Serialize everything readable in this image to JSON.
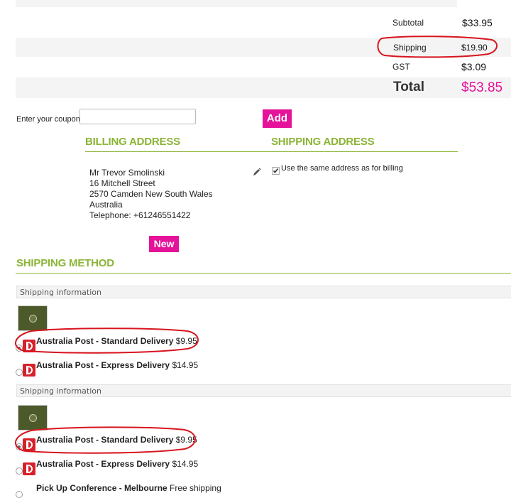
{
  "totals": {
    "subtotal_label": "Subtotal",
    "subtotal_value": "$33.95",
    "shipping_label": "Shipping",
    "shipping_value": "$19.90",
    "gst_label": "GST",
    "gst_value": "$3.09",
    "total_label": "Total",
    "total_value": "$53.85"
  },
  "coupon": {
    "label": "Enter your coupon",
    "value": "",
    "add_label": "Add"
  },
  "billing": {
    "heading": "BILLING ADDRESS",
    "lines": [
      "Mr Trevor Smolinski",
      "16 Mitchell Street",
      "2570 Camden New South Wales",
      "Australia",
      "Telephone: +61246551422"
    ],
    "new_label": "New",
    "edit_icon": "pencil-icon"
  },
  "shipping_address": {
    "heading": "SHIPPING ADDRESS",
    "same_as_billing_label": "Use the same address as for billing",
    "same_as_billing_checked": true
  },
  "shipping_method": {
    "heading": "SHIPPING METHOD",
    "groups": [
      {
        "info_label": "Shipping information",
        "options": [
          {
            "name": "Australia Post - Standard Delivery",
            "price": "$9.95",
            "selected": true
          },
          {
            "name": "Australia Post - Express Delivery",
            "price": "$14.95",
            "selected": false
          }
        ]
      },
      {
        "info_label": "Shipping information",
        "options": [
          {
            "name": "Australia Post - Standard Delivery",
            "price": "$9.95",
            "selected": true
          },
          {
            "name": "Australia Post - Express Delivery",
            "price": "$14.95",
            "selected": false
          },
          {
            "name": "Pick Up Conference - Melbourne",
            "price": "Free shipping",
            "selected": false
          }
        ]
      }
    ]
  },
  "colors": {
    "accent_pink": "#e5139a",
    "heading_green": "#8bb436",
    "annotation_red": "#d8141e"
  }
}
